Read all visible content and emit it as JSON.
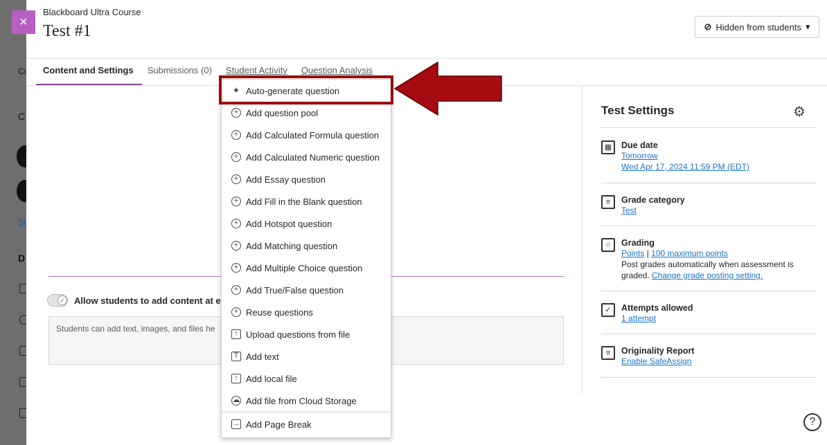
{
  "course_name": "Blackboard Ultra Course",
  "page_title": "Test #1",
  "close_icon": "×",
  "visibility_button": {
    "label": "Hidden from students",
    "icon": "eye-slash-icon",
    "caret": "▾"
  },
  "tabs": [
    {
      "label": "Content and Settings",
      "active": true
    },
    {
      "label": "Submissions (0)",
      "active": false
    },
    {
      "label": "Student Activity",
      "active": false
    },
    {
      "label": "Question Analysis",
      "active": false
    }
  ],
  "background_fragments": {
    "c1": "Co",
    "c2": "C",
    "c3": "Sl",
    "c4": "D"
  },
  "allow_students_label": "Allow students to add content at end",
  "students_box_text": "Students can add text, images, and files he",
  "settings": {
    "title": "Test Settings",
    "due_date": {
      "label": "Due date",
      "line1": "Tomorrow",
      "line2": "Wed Apr 17, 2024 11:59 PM (EDT)"
    },
    "grade_category": {
      "label": "Grade category",
      "value": "Test"
    },
    "grading": {
      "label": "Grading",
      "points": "Points",
      "sep": "|",
      "max": "100 maximum points",
      "line2": "Post grades automatically when assessment is",
      "line3_prefix": "graded.",
      "line3_link": "Change grade posting setting."
    },
    "attempts": {
      "label": "Attempts allowed",
      "value": "1 attempt"
    },
    "originality": {
      "label": "Originality Report",
      "value": "Enable SafeAssign"
    }
  },
  "menu": [
    {
      "label": "Auto-generate question",
      "icon": "sparkle-icon"
    },
    {
      "label": "Add question pool",
      "icon": "plus-circle-icon"
    },
    {
      "label": "Add Calculated Formula question",
      "icon": "plus-circle-icon"
    },
    {
      "label": "Add Calculated Numeric question",
      "icon": "plus-circle-icon"
    },
    {
      "label": "Add Essay question",
      "icon": "plus-circle-icon"
    },
    {
      "label": "Add Fill in the Blank question",
      "icon": "plus-circle-icon"
    },
    {
      "label": "Add Hotspot question",
      "icon": "plus-circle-icon"
    },
    {
      "label": "Add Matching question",
      "icon": "plus-circle-icon"
    },
    {
      "label": "Add Multiple Choice question",
      "icon": "plus-circle-icon"
    },
    {
      "label": "Add True/False question",
      "icon": "plus-circle-icon"
    },
    {
      "label": "Reuse questions",
      "icon": "plus-circle-icon"
    },
    {
      "label": "Upload questions from file",
      "icon": "upload-file-icon"
    },
    {
      "label": "Add text",
      "icon": "text-icon"
    },
    {
      "label": "Add local file",
      "icon": "local-file-icon"
    },
    {
      "label": "Add file from Cloud Storage",
      "icon": "cloud-icon"
    },
    {
      "label": "Add Page Break",
      "icon": "page-break-icon"
    }
  ],
  "help_icon": "?"
}
